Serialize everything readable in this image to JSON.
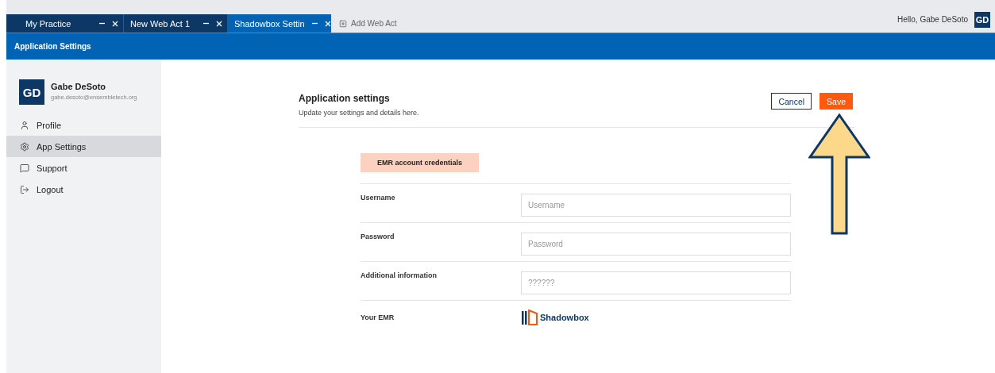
{
  "tabs": [
    {
      "label": "My Practice",
      "selected": false
    },
    {
      "label": "New Web Act 1",
      "selected": false
    },
    {
      "label": "Shadowbox Settin",
      "selected": true
    }
  ],
  "add_tab": "Add Web Act",
  "greeting": "Hello, Gabe DeSoto",
  "user_initials": "GD",
  "header_title": "Application Settings",
  "sidebar": {
    "initials": "GD",
    "name": "Gabe DeSoto",
    "email": "gabe.desoto@ensembletech.org",
    "items": [
      {
        "label": "Profile",
        "selected": false
      },
      {
        "label": "App Settings",
        "selected": true
      },
      {
        "label": "Support",
        "selected": false
      },
      {
        "label": "Logout",
        "selected": false
      }
    ]
  },
  "page": {
    "title": "Application settings",
    "subtitle": "Update your settings and details here.",
    "buttons": [
      {
        "label": "Cancel",
        "kind": "secondary"
      },
      {
        "label": "Save",
        "kind": "primary"
      }
    ]
  },
  "section_badge": "EMR account credentials",
  "fields": [
    {
      "label": "Username",
      "placeholder": "Username"
    },
    {
      "label": "Password",
      "placeholder": "Password"
    },
    {
      "label": "Additional information",
      "placeholder": "??????"
    }
  ],
  "emr": {
    "label": "Your EMR",
    "name": "Shadowbox"
  },
  "annotation": {
    "kind": "arrow"
  }
}
